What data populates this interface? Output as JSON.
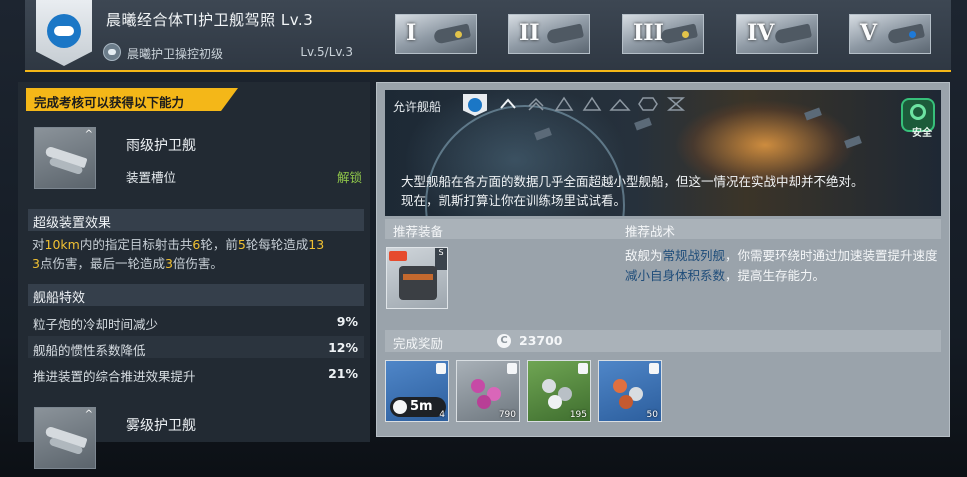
{
  "header": {
    "title": "晨曦经合体TI护卫舰驾照 Lv.3",
    "sub_label": "晨曦护卫操控初级",
    "sub_level": "Lv.5/Lv.3",
    "stages": [
      "I",
      "II",
      "III",
      "IV",
      "V"
    ]
  },
  "left": {
    "banner": "完成考核可以获得以下能力",
    "ship1": {
      "name": "雨级护卫舰",
      "slot": "装置槽位",
      "unlock": "解锁"
    },
    "super_title": "超级装置效果",
    "super_parts": [
      "对",
      "10km",
      "内的指定目标射击共",
      "6",
      "轮，前",
      "5",
      "轮每轮造成",
      "13",
      "3",
      "点伤害，最后一轮造成",
      "3",
      "倍伤害。"
    ],
    "traits_title": "舰船特效",
    "traits": [
      {
        "text": "粒子炮的冷却时间减少",
        "value": "9%"
      },
      {
        "text": "舰船的惯性系数降低",
        "value": "12%"
      },
      {
        "text": "推进装置的综合推进效果提升",
        "value": "21%"
      }
    ],
    "ship2": {
      "name": "雾级护卫舰"
    }
  },
  "right": {
    "allowed_label": "允许舰船",
    "safe_label": "安全",
    "desc_line1": "大型舰船在各方面的数据几乎全面超越小型舰船，但这一情况在实战中却并不绝对。",
    "desc_line2": "现在，凯斯打算让你在训练场里试试看。",
    "rec_equip": "推荐装备",
    "rec_tactic": "推荐战术",
    "tactic_parts": [
      "敌舰为",
      "常规战列舰",
      "，你需要环绕时通过加速装置提升速度",
      "减小自身体积系数",
      "，提高生存能力。"
    ],
    "reward_label": "完成奖励",
    "coin_symbol": "C",
    "reward_amount": "23700",
    "rewards": [
      {
        "label": "5m",
        "qty": "4"
      },
      {
        "qty": "790"
      },
      {
        "qty": "195"
      },
      {
        "qty": "50"
      }
    ]
  },
  "colors": {
    "accent": "#f4b718",
    "unlock": "#8fc64a",
    "safe": "#37c07a"
  }
}
